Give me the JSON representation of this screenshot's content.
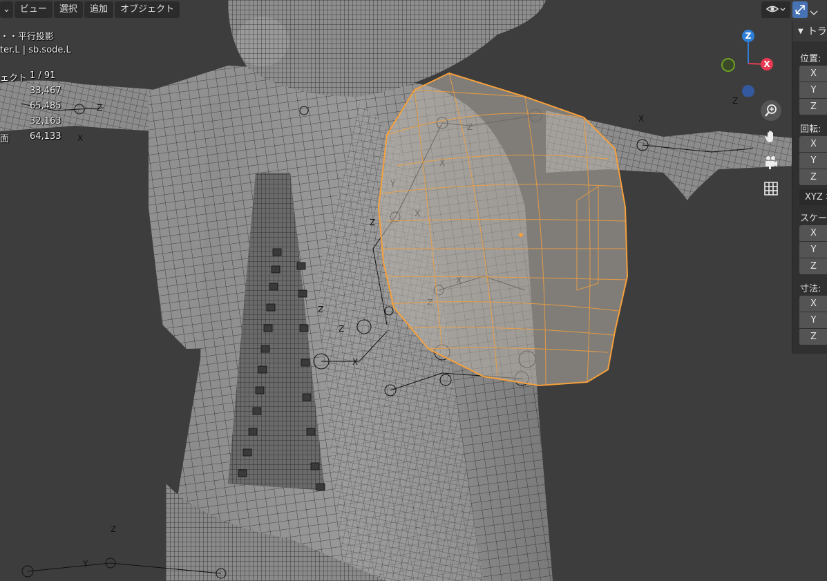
{
  "header_menu": {
    "mode_dropdown": "⌄",
    "items": [
      "ビュー",
      "選択",
      "追加",
      "オブジェクト"
    ]
  },
  "overlay": {
    "view_name": "・・平行投影",
    "object_path": "ter.L | sb.sode.L",
    "stats": [
      {
        "label": "ェクト",
        "value": "1 / 91"
      },
      {
        "label": "",
        "value": "33,467"
      },
      {
        "label": "",
        "value": "65,485"
      },
      {
        "label": "",
        "value": "32,163"
      },
      {
        "label": "面",
        "value": "64,133"
      }
    ]
  },
  "gizmo": {
    "z_label": "Z",
    "x_label": "X",
    "colors": {
      "x": "#e83a52",
      "y": "#6ea023",
      "z": "#2f7fd8",
      "neg_z": "#34599e"
    }
  },
  "nav_tools": [
    "zoom-icon",
    "hand-icon",
    "camera-icon",
    "grid-icon"
  ],
  "sidebar": {
    "panel_title": "トラ",
    "location": {
      "label": "位置:",
      "axes": [
        "X",
        "Y",
        "Z"
      ]
    },
    "rotation": {
      "label": "回転:",
      "axes": [
        "X",
        "Y",
        "Z"
      ],
      "mode": "XYZ オ"
    },
    "scale": {
      "label": "スケール",
      "axes": [
        "X",
        "Y",
        "Z"
      ]
    },
    "dimensions": {
      "label": "寸法:",
      "axes": [
        "X",
        "Y",
        "Z"
      ]
    }
  },
  "colors": {
    "viewport_bg": "#3d3d3d",
    "selection": "#f5a03c",
    "active_header": "#4772b3"
  }
}
